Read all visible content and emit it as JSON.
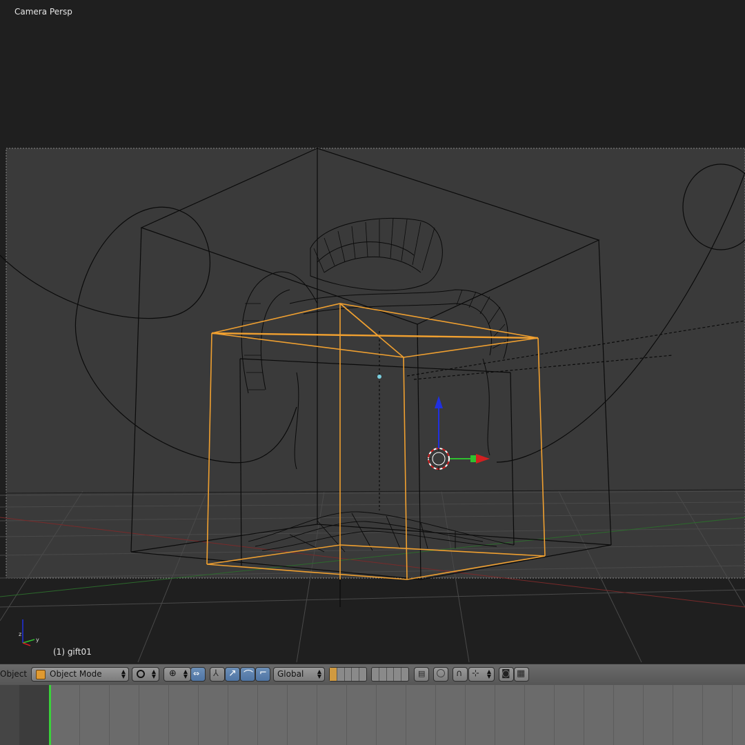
{
  "viewport": {
    "view_label": "Camera Persp",
    "object_label": "(1) gift01"
  },
  "header": {
    "menu_object": "Object",
    "mode_select": "Object Mode",
    "orientation_select": "Global"
  },
  "timeline": {
    "current_frame_marker": "green"
  },
  "colors": {
    "viewport_bg": "#1f1f1f",
    "camera_frame_bg": "#3a3a3a",
    "selection_orange": "#f0a030",
    "wire_black": "#0a0a0a",
    "axis_red": "#d22020",
    "axis_green": "#2fc02f",
    "axis_blue": "#2030e0",
    "timeline_cursor": "#3ad23a"
  },
  "icons": [
    "object-cube-icon",
    "viewport-shading-icon",
    "pivot-icon",
    "manipulator-icon",
    "translate-icon",
    "rotate-icon",
    "scale-icon",
    "layers-icon",
    "proportional-edit-icon",
    "snap-icon",
    "render-icon",
    "render-animation-icon"
  ]
}
